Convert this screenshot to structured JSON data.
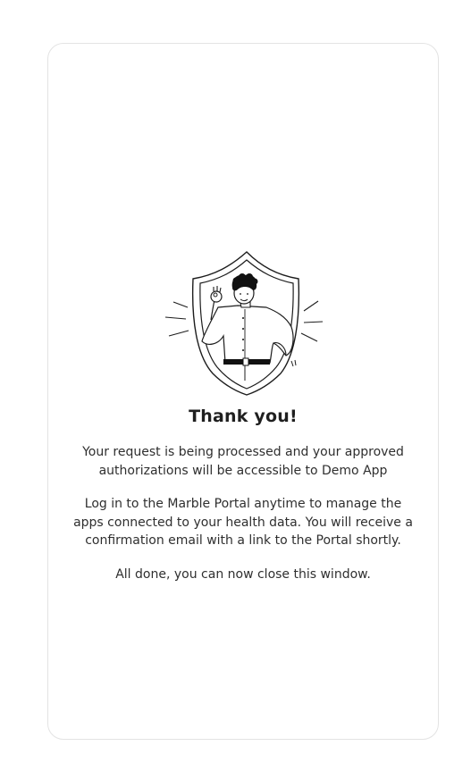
{
  "confirmation": {
    "illustration_icon": "person-in-shield-ok-gesture-illustration",
    "title": "Thank you!",
    "message_processing": "Your request is being processed and your approved authorizations will be accessible to Demo App",
    "message_portal": "Log in to the Marble Portal anytime to manage the apps connected to your health data. You will receive a confirmation email with a link to the Portal shortly.",
    "message_done": "All done, you can now close this window."
  }
}
